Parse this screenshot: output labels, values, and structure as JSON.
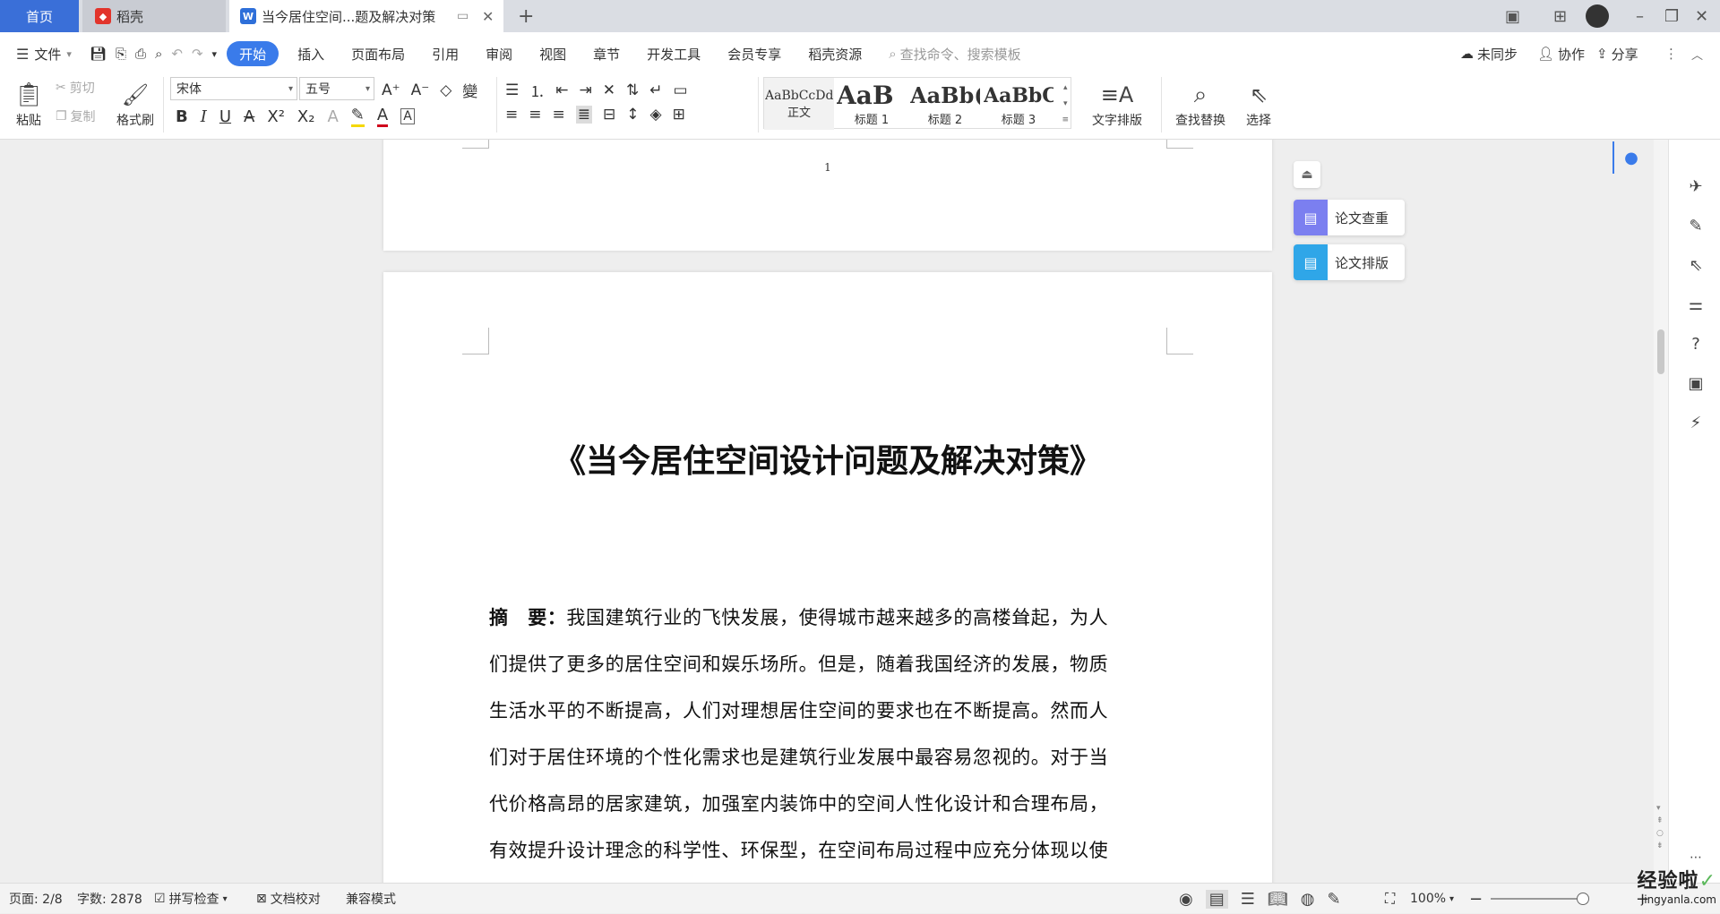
{
  "tabs": {
    "home": "首页",
    "shell": "稻壳",
    "doc": "当今居住空间...题及解决对策"
  },
  "menu": {
    "file": "文件",
    "items": [
      "开始",
      "插入",
      "页面布局",
      "引用",
      "审阅",
      "视图",
      "章节",
      "开发工具",
      "会员专享",
      "稻壳资源"
    ],
    "search_placeholder": "查找命令、搜索模板",
    "sync": "未同步",
    "collab": "协作",
    "share": "分享"
  },
  "ribbon": {
    "paste": "粘贴",
    "cut": "剪切",
    "copy": "复制",
    "format_painter": "格式刷",
    "font": "宋体",
    "size": "五号",
    "styles": [
      {
        "preview": "AaBbCcDd",
        "name": "正文"
      },
      {
        "preview": "AaB",
        "name": "标题 1"
      },
      {
        "preview": "AaBb(",
        "name": "标题 2"
      },
      {
        "preview": "AaBbC",
        "name": "标题 3"
      }
    ],
    "text_layout": "文字排版",
    "find_replace": "查找替换",
    "select": "选择"
  },
  "document": {
    "page_number": "1",
    "title": "《当今居住空间设计问题及解决对策》",
    "abstract_label": "摘　要：",
    "lines": [
      "我国建筑行业的飞快发展，使得城市越来越多的高楼耸起，为人",
      "们提供了更多的居住空间和娱乐场所。但是，随着我国经济的发展，物质",
      "生活水平的不断提高，人们对理想居住空间的要求也在不断提高。然而人",
      "们对于居住环境的个性化需求也是建筑行业发展中最容易忽视的。对于当",
      "代价格高昂的居家建筑，加强室内装饰中的空间人性化设计和合理布局，",
      "有效提升设计理念的科学性、环保型，在空间布局过程中应充分体现以使"
    ]
  },
  "float_panel": {
    "check": "论文查重",
    "layout": "论文排版"
  },
  "status": {
    "page": "页面: 2/8",
    "words": "字数: 2878",
    "spell": "拼写检查",
    "proof": "文档校对",
    "compat": "兼容模式",
    "zoom": "100%"
  },
  "watermark": {
    "text": "经验啦",
    "url": "jingyanla.com"
  },
  "colors": {
    "accent": "#3a7bea",
    "home_tab": "#3a6fd8",
    "check_icon": "#7b7ff0",
    "layout_icon": "#2fa6e8"
  }
}
